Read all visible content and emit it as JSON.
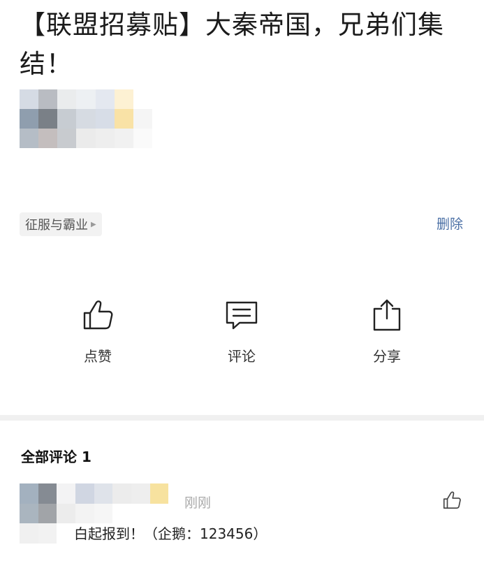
{
  "post": {
    "title": "【联盟招募贴】大秦帝国，兄弟们集结！",
    "tag": "征服与霸业",
    "delete_label": "删除"
  },
  "actions": {
    "like": {
      "label": "点赞",
      "icon": "thumbs-up-icon"
    },
    "comment": {
      "label": "评论",
      "icon": "comment-icon"
    },
    "share": {
      "label": "分享",
      "icon": "share-icon"
    }
  },
  "comments": {
    "header": "全部评论 1",
    "items": [
      {
        "time": "刚刚",
        "text": "白起报到！（企鹅：123456）"
      }
    ]
  },
  "colors": {
    "link": "#4a6fa5",
    "divider": "#f0f0f0",
    "tag_bg": "#f2f2f2"
  }
}
